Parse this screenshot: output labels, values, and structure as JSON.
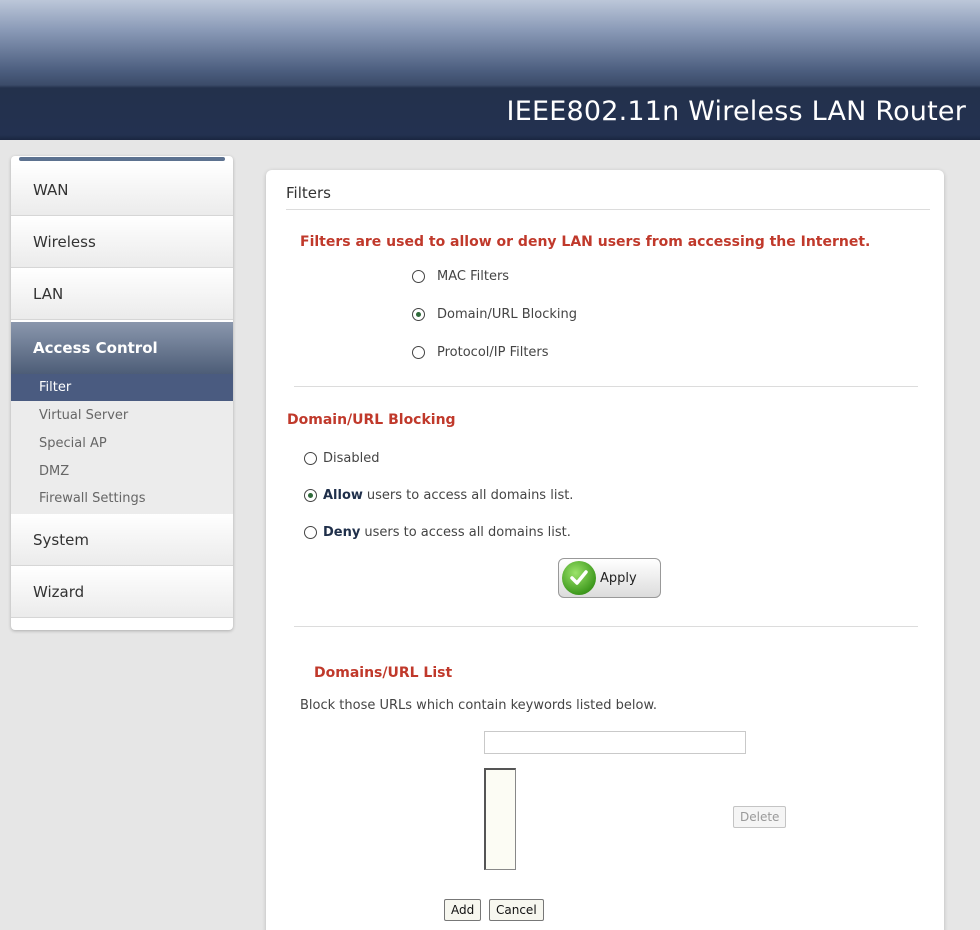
{
  "header": {
    "title": "IEEE802.11n  Wireless LAN Router"
  },
  "sidebar": {
    "items": [
      {
        "label": "WAN"
      },
      {
        "label": "Wireless"
      },
      {
        "label": "LAN"
      },
      {
        "label": "Access Control",
        "active": true
      },
      {
        "label": "System"
      },
      {
        "label": "Wizard"
      }
    ],
    "submenu": [
      {
        "label": "Filter",
        "active": true
      },
      {
        "label": "Virtual Server"
      },
      {
        "label": "Special AP"
      },
      {
        "label": "DMZ"
      },
      {
        "label": "Firewall Settings"
      }
    ]
  },
  "main": {
    "title": "Filters",
    "intro": "Filters are used to allow or deny LAN users from accessing the Internet.",
    "filter_types": [
      {
        "label": "MAC Filters",
        "checked": false
      },
      {
        "label": "Domain/URL Blocking",
        "checked": true
      },
      {
        "label": "Protocol/IP Filters",
        "checked": false
      }
    ],
    "blocking": {
      "title": "Domain/URL Blocking",
      "options": [
        {
          "bold": "",
          "label": "Disabled",
          "checked": false
        },
        {
          "bold": "Allow",
          "label": "users to access all domains list.",
          "checked": true
        },
        {
          "bold": "Deny",
          "label": "users to access all domains list.",
          "checked": false
        }
      ],
      "apply_label": "Apply"
    },
    "list": {
      "title": "Domains/URL List",
      "description": "Block those URLs which contain keywords listed below.",
      "keyword_value": "",
      "delete_label": "Delete",
      "add_label": "Add",
      "cancel_label": "Cancel"
    }
  },
  "colors": {
    "accent_red": "#c0392b",
    "nav_active": "#4a5b80",
    "header_dark": "#233150"
  }
}
